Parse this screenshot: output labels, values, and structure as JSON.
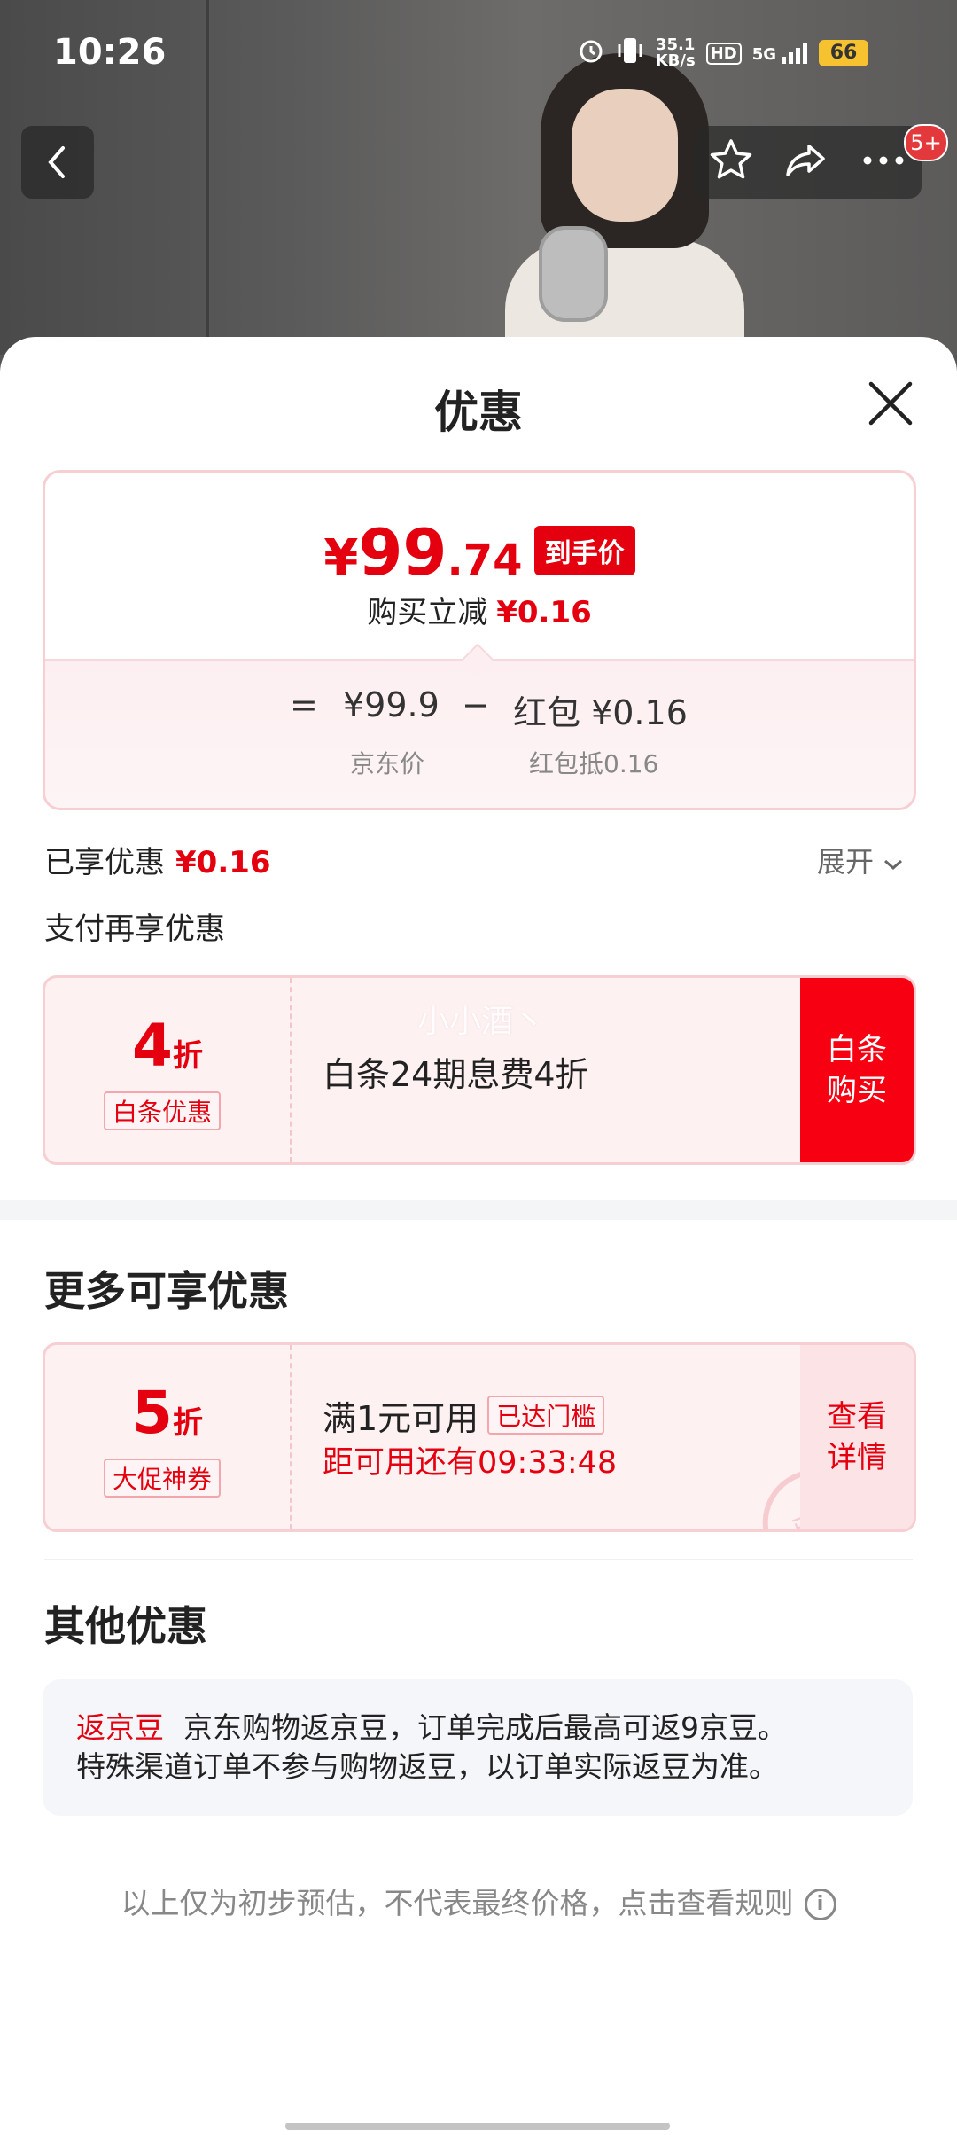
{
  "status_bar": {
    "time": "10:26",
    "speed": "35.1",
    "speed_unit": "KB/s",
    "hd": "HD",
    "network": "5G",
    "battery": "66"
  },
  "nav": {
    "badge": "5+"
  },
  "sheet": {
    "title": "优惠"
  },
  "price_card": {
    "currency": "¥",
    "final_int": "99",
    "final_dec": ".74",
    "final_tag": "到手价",
    "instant_label": "购买立减",
    "instant_value": "¥0.16",
    "eq": "=",
    "jd_price": "¥99.9",
    "minus": "−",
    "redpacket": "红包 ¥0.16",
    "jd_price_label": "京东价",
    "redpacket_label": "红包抵0.16"
  },
  "enjoyed": {
    "label": "已享优惠",
    "value": "¥0.16",
    "expand": "展开"
  },
  "pay_more": {
    "label": "支付再享优惠"
  },
  "baitiao_coupon": {
    "num": "4",
    "unit": "折",
    "tag": "白条优惠",
    "desc": "白条24期息费4折",
    "action": "白条\n购买",
    "watermark": "小小酒丶"
  },
  "more": {
    "title": "更多可享优惠"
  },
  "promo_coupon": {
    "num": "5",
    "unit": "折",
    "tag": "大促神券",
    "desc": "满1元可用",
    "threshold_tag": "已达门槛",
    "countdown": "距可用还有09:33:48",
    "action": "查看\n详情",
    "stamp": "已领"
  },
  "other": {
    "title": "其他优惠",
    "type": "返京豆",
    "line1": "京东购物返京豆，订单完成后最高可返9京豆。",
    "line2": "特殊渠道订单不参与购物返豆，以订单实际返豆为准。"
  },
  "disclaimer": "以上仅为初步预估，不代表最终价格，点击查看规则",
  "colors": {
    "accent": "#e4000f",
    "card_border": "#f7cfd3",
    "card_bg": "#fdf1f2"
  }
}
